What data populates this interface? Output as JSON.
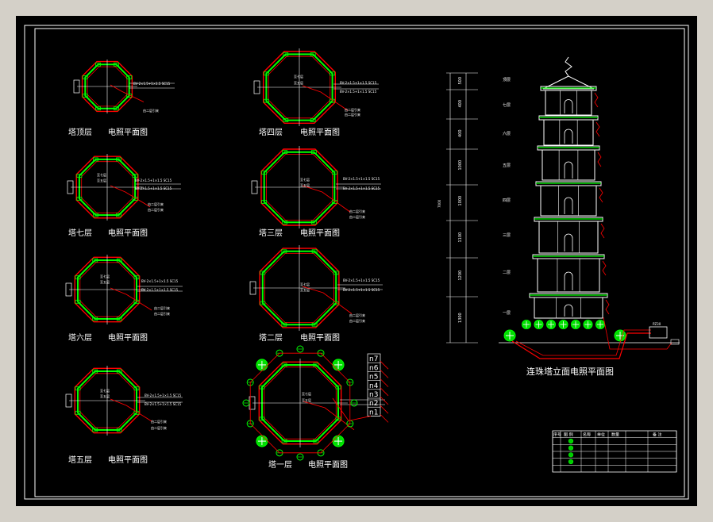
{
  "colors": {
    "canvas": "#000000",
    "outer_frame": "#d4d0c8",
    "wall": "#00ff00",
    "wire": "#ff0000",
    "text": "#ffffff",
    "dim": "#ffff00"
  },
  "plans": {
    "top": {
      "label": "塔顶层",
      "sub": "电照平面图"
    },
    "seventh": {
      "label": "塔七层",
      "sub": "电照平面图"
    },
    "sixth": {
      "label": "塔六层",
      "sub": "电照平面图"
    },
    "fifth": {
      "label": "塔五层",
      "sub": "电照平面图"
    },
    "fourth": {
      "label": "塔四层",
      "sub": "电照平面图"
    },
    "third": {
      "label": "塔三层",
      "sub": "电照平面图"
    },
    "second": {
      "label": "塔二层",
      "sub": "电照平面图"
    },
    "first": {
      "label": "塔一层",
      "sub": "电照平面图"
    }
  },
  "elevation": {
    "title": "连珠塔立面电照平面图",
    "floor_labels": [
      "顶层",
      "七层",
      "六层",
      "五层",
      "四层",
      "三层",
      "二层",
      "一层"
    ],
    "dims": [
      "500",
      "400",
      "400",
      "1000",
      "1000",
      "1100",
      "1200",
      "1300"
    ],
    "total": "7000",
    "feeder": "PZ30"
  },
  "riser": {
    "labels": [
      "n7",
      "n6",
      "n5",
      "n4",
      "n3",
      "n2",
      "n1"
    ]
  },
  "annotations": {
    "cable": "BV-2×1.5+1×1.5 SC15",
    "lamp_upper": "至七层",
    "lamp_lower": "至五层",
    "riser_note": "由二层引来"
  },
  "legend": {
    "headers": [
      "序号",
      "图 例",
      "名称",
      "单位",
      "数量",
      "备 注"
    ]
  }
}
